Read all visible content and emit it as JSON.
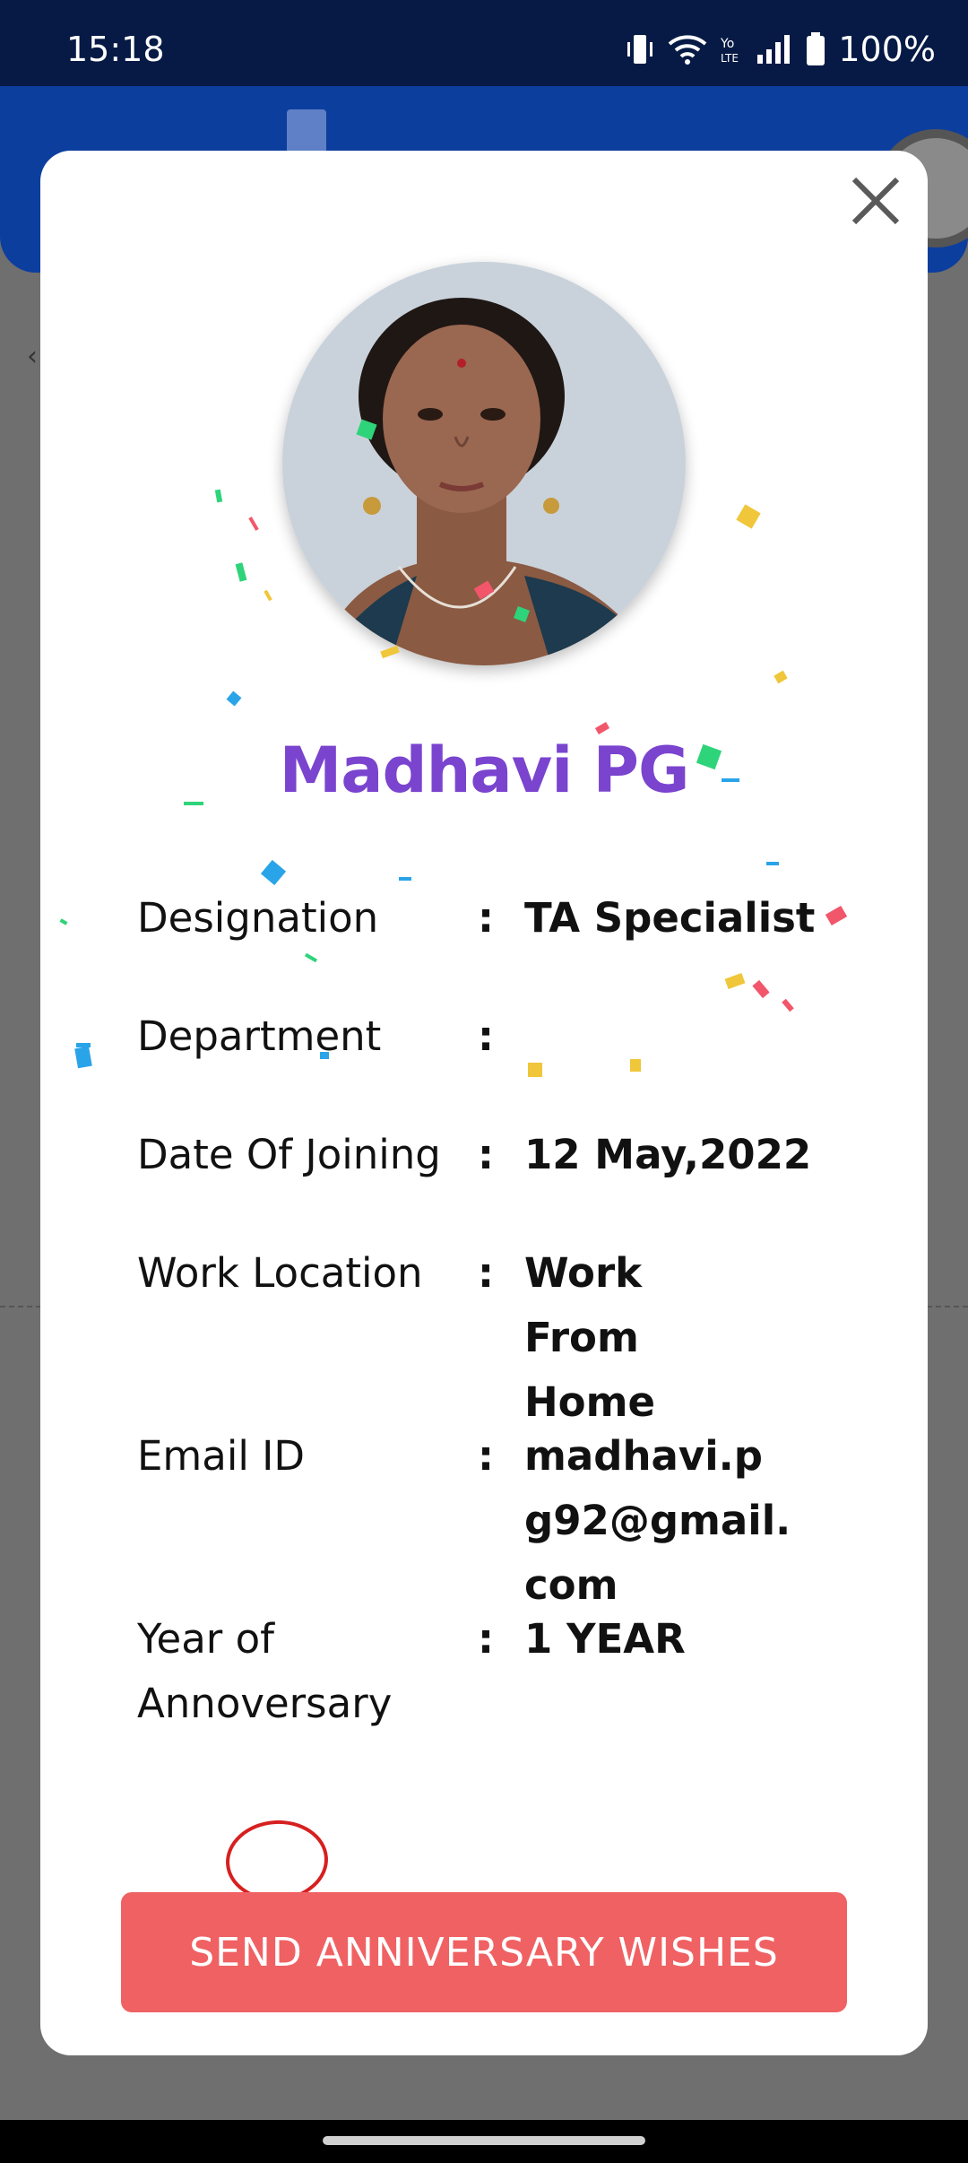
{
  "status_bar": {
    "time": "15:18",
    "battery": "100%"
  },
  "dialog": {
    "employee_name": "Madhavi PG",
    "fields": [
      {
        "label": "Designation",
        "value": "TA Specialist"
      },
      {
        "label": "Department",
        "value": ""
      },
      {
        "label": "Date Of Joining",
        "value": "12 May,2022"
      },
      {
        "label": "Work Location",
        "value": "Work From Home"
      },
      {
        "label": "Email ID",
        "value": "madhavi.pg92@gmail.com"
      },
      {
        "label": "Year of Annoversary",
        "value": "1 YEAR"
      }
    ],
    "separator": ":",
    "send_button_label": "SEND ANNIVERSARY WISHES",
    "close_icon": "close-icon",
    "confetti_colors": [
      "#2ed47a",
      "#f0c63a",
      "#f2566a",
      "#2aa4e8"
    ]
  },
  "colors": {
    "name": "#7a44cf",
    "button": "#f06163",
    "status_bar": "#061a45",
    "header": "#0c3e9e"
  }
}
